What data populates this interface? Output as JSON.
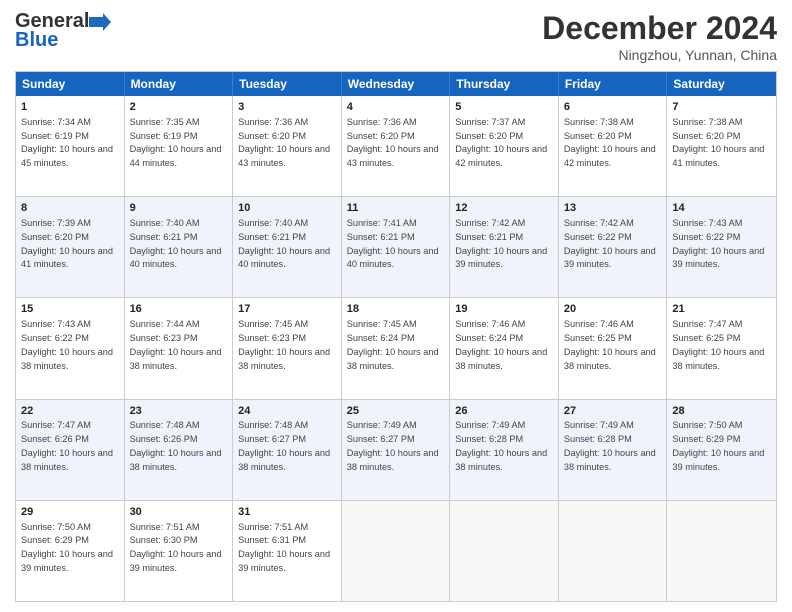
{
  "header": {
    "logo_general": "General",
    "logo_blue": "Blue",
    "month_year": "December 2024",
    "location": "Ningzhou, Yunnan, China"
  },
  "days_of_week": [
    "Sunday",
    "Monday",
    "Tuesday",
    "Wednesday",
    "Thursday",
    "Friday",
    "Saturday"
  ],
  "weeks": [
    [
      {
        "day": "1",
        "sunrise": "7:34 AM",
        "sunset": "6:19 PM",
        "daylight": "10 hours and 45 minutes."
      },
      {
        "day": "2",
        "sunrise": "7:35 AM",
        "sunset": "6:19 PM",
        "daylight": "10 hours and 44 minutes."
      },
      {
        "day": "3",
        "sunrise": "7:36 AM",
        "sunset": "6:20 PM",
        "daylight": "10 hours and 43 minutes."
      },
      {
        "day": "4",
        "sunrise": "7:36 AM",
        "sunset": "6:20 PM",
        "daylight": "10 hours and 43 minutes."
      },
      {
        "day": "5",
        "sunrise": "7:37 AM",
        "sunset": "6:20 PM",
        "daylight": "10 hours and 42 minutes."
      },
      {
        "day": "6",
        "sunrise": "7:38 AM",
        "sunset": "6:20 PM",
        "daylight": "10 hours and 42 minutes."
      },
      {
        "day": "7",
        "sunrise": "7:38 AM",
        "sunset": "6:20 PM",
        "daylight": "10 hours and 41 minutes."
      }
    ],
    [
      {
        "day": "8",
        "sunrise": "7:39 AM",
        "sunset": "6:20 PM",
        "daylight": "10 hours and 41 minutes."
      },
      {
        "day": "9",
        "sunrise": "7:40 AM",
        "sunset": "6:21 PM",
        "daylight": "10 hours and 40 minutes."
      },
      {
        "day": "10",
        "sunrise": "7:40 AM",
        "sunset": "6:21 PM",
        "daylight": "10 hours and 40 minutes."
      },
      {
        "day": "11",
        "sunrise": "7:41 AM",
        "sunset": "6:21 PM",
        "daylight": "10 hours and 40 minutes."
      },
      {
        "day": "12",
        "sunrise": "7:42 AM",
        "sunset": "6:21 PM",
        "daylight": "10 hours and 39 minutes."
      },
      {
        "day": "13",
        "sunrise": "7:42 AM",
        "sunset": "6:22 PM",
        "daylight": "10 hours and 39 minutes."
      },
      {
        "day": "14",
        "sunrise": "7:43 AM",
        "sunset": "6:22 PM",
        "daylight": "10 hours and 39 minutes."
      }
    ],
    [
      {
        "day": "15",
        "sunrise": "7:43 AM",
        "sunset": "6:22 PM",
        "daylight": "10 hours and 38 minutes."
      },
      {
        "day": "16",
        "sunrise": "7:44 AM",
        "sunset": "6:23 PM",
        "daylight": "10 hours and 38 minutes."
      },
      {
        "day": "17",
        "sunrise": "7:45 AM",
        "sunset": "6:23 PM",
        "daylight": "10 hours and 38 minutes."
      },
      {
        "day": "18",
        "sunrise": "7:45 AM",
        "sunset": "6:24 PM",
        "daylight": "10 hours and 38 minutes."
      },
      {
        "day": "19",
        "sunrise": "7:46 AM",
        "sunset": "6:24 PM",
        "daylight": "10 hours and 38 minutes."
      },
      {
        "day": "20",
        "sunrise": "7:46 AM",
        "sunset": "6:25 PM",
        "daylight": "10 hours and 38 minutes."
      },
      {
        "day": "21",
        "sunrise": "7:47 AM",
        "sunset": "6:25 PM",
        "daylight": "10 hours and 38 minutes."
      }
    ],
    [
      {
        "day": "22",
        "sunrise": "7:47 AM",
        "sunset": "6:26 PM",
        "daylight": "10 hours and 38 minutes."
      },
      {
        "day": "23",
        "sunrise": "7:48 AM",
        "sunset": "6:26 PM",
        "daylight": "10 hours and 38 minutes."
      },
      {
        "day": "24",
        "sunrise": "7:48 AM",
        "sunset": "6:27 PM",
        "daylight": "10 hours and 38 minutes."
      },
      {
        "day": "25",
        "sunrise": "7:49 AM",
        "sunset": "6:27 PM",
        "daylight": "10 hours and 38 minutes."
      },
      {
        "day": "26",
        "sunrise": "7:49 AM",
        "sunset": "6:28 PM",
        "daylight": "10 hours and 38 minutes."
      },
      {
        "day": "27",
        "sunrise": "7:49 AM",
        "sunset": "6:28 PM",
        "daylight": "10 hours and 38 minutes."
      },
      {
        "day": "28",
        "sunrise": "7:50 AM",
        "sunset": "6:29 PM",
        "daylight": "10 hours and 39 minutes."
      }
    ],
    [
      {
        "day": "29",
        "sunrise": "7:50 AM",
        "sunset": "6:29 PM",
        "daylight": "10 hours and 39 minutes."
      },
      {
        "day": "30",
        "sunrise": "7:51 AM",
        "sunset": "6:30 PM",
        "daylight": "10 hours and 39 minutes."
      },
      {
        "day": "31",
        "sunrise": "7:51 AM",
        "sunset": "6:31 PM",
        "daylight": "10 hours and 39 minutes."
      },
      null,
      null,
      null,
      null
    ]
  ]
}
